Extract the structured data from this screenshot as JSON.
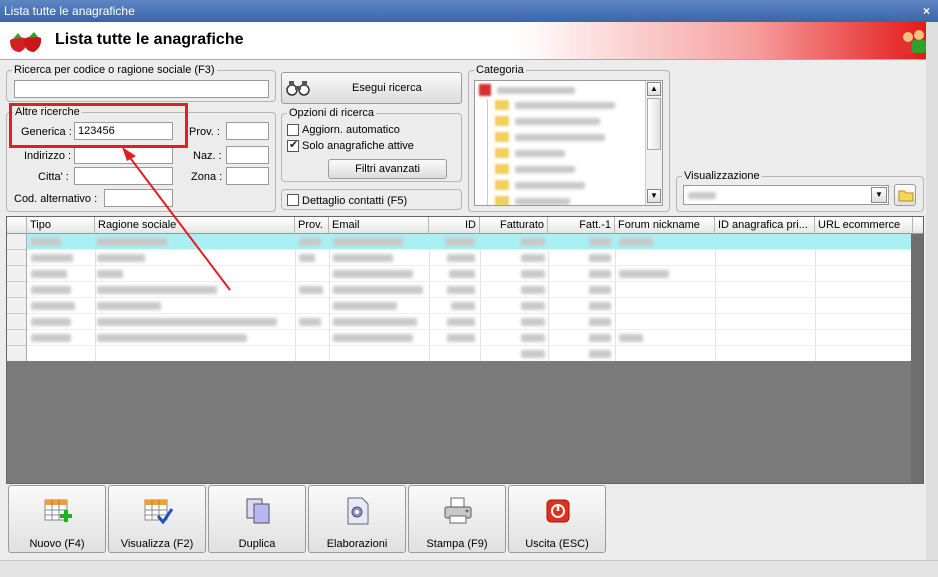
{
  "window": {
    "title": "Lista tutte le anagrafiche",
    "close": "×"
  },
  "header": {
    "title": "Lista tutte le anagrafiche"
  },
  "search_code": {
    "legend": "Ricerca per codice o ragione sociale (F3)",
    "value": ""
  },
  "execute_button": {
    "label": "Esegui ricerca"
  },
  "other_searches": {
    "legend": "Altre ricerche",
    "generica_label": "Generica :",
    "generica_value": "123456",
    "indirizzo_label": "Indirizzo :",
    "citta_label": "Citta' :",
    "cod_alt_label": "Cod. alternativo :",
    "prov_label": "Prov. :",
    "naz_label": "Naz. :",
    "zona_label": "Zona :"
  },
  "options": {
    "legend": "Opzioni di ricerca",
    "auto_update": "Aggiorn. automatico",
    "auto_update_checked": false,
    "active_only": "Solo anagrafiche attive",
    "active_only_checked": true,
    "advanced_filters": "Filtri avanzati"
  },
  "contact_detail": {
    "label": "Dettaglio contatti (F5)",
    "checked": false
  },
  "category": {
    "legend": "Categoria"
  },
  "view": {
    "legend": "Visualizzazione"
  },
  "grid": {
    "columns": [
      "Tipo",
      "Ragione sociale",
      "Prov.",
      "Email",
      "ID",
      "Fatturato",
      "Fatt.-1",
      "Forum nickname",
      "ID anagrafica pri...",
      "URL ecommerce"
    ]
  },
  "actions": [
    {
      "label": "Nuovo (F4)",
      "icon": "new-record-icon"
    },
    {
      "label": "Visualizza (F2)",
      "icon": "view-record-icon"
    },
    {
      "label": "Duplica",
      "icon": "duplicate-icon"
    },
    {
      "label": "Elaborazioni",
      "icon": "processing-icon"
    },
    {
      "label": "Stampa (F9)",
      "icon": "printer-icon"
    },
    {
      "label": "Uscita (ESC)",
      "icon": "exit-icon"
    }
  ],
  "colors": {
    "title_bar": "#4a74b6",
    "highlight": "#e02020",
    "selected_row": "#a8f0f4",
    "header_gradient_end": "#e41010"
  }
}
